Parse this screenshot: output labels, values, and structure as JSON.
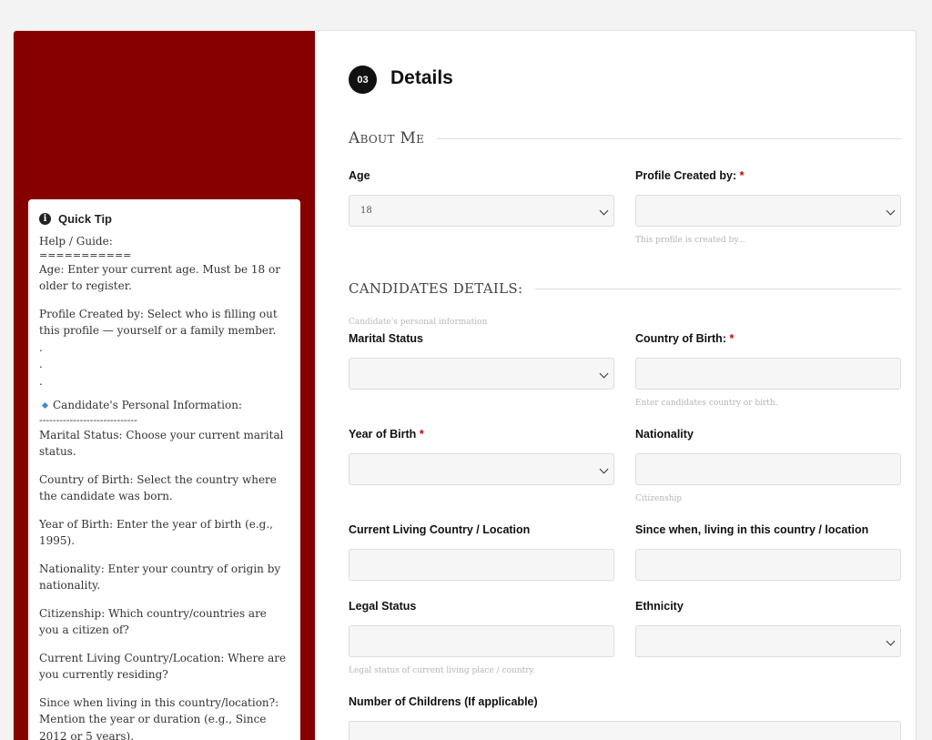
{
  "tip": {
    "title": "Quick Tip",
    "help_heading": "Help / Guide:",
    "help_rule": "===========",
    "age_tip": "Age: Enter your current age. Must be 18 or older to register.",
    "profile_tip": "Profile Created by: Select who is filling out this profile — yourself or a family member.",
    "dot": ".",
    "candidate_heading": "Candidate's Personal Information:",
    "candidate_rule": "-----------------------------",
    "marital_tip": "Marital Status: Choose your current marital status.",
    "country_tip": "Country of Birth: Select the country where the candidate was born.",
    "year_tip": "Year of Birth: Enter the year of birth (e.g., 1995).",
    "nationality_tip": "Nationality: Enter your country of origin by nationality.",
    "citizenship_tip": "Citizenship: Which country/countries are you a citizen of?",
    "living_tip": "Current Living Country/Location: Where are you currently residing?",
    "since_tip": "Since when living in this country/location?: Mention the year or duration (e.g., Since 2012 or 5 years)."
  },
  "step": {
    "number": "03",
    "title": "Details"
  },
  "about": {
    "title": "About Me",
    "age_label": "Age",
    "age_value": "18",
    "profile_label": "Profile Created by:",
    "profile_value": "",
    "profile_hint": "This profile is created by..."
  },
  "candidate": {
    "title": "CANDIDATES DETAILS:",
    "subtitle": "Candidate's personal information",
    "marital_label": "Marital Status",
    "marital_value": "",
    "country_label": "Country of Birth:",
    "country_value": "",
    "country_hint": "Enter candidates country or birth.",
    "year_label": "Year of Birth",
    "year_value": "",
    "nationality_label": "Nationality",
    "nationality_value": "",
    "nationality_hint": "Citizenship",
    "living_label": "Current Living Country / Location",
    "living_value": "",
    "since_label": "Since when, living in this country / location",
    "since_value": "",
    "legal_label": "Legal Status",
    "legal_value": "",
    "legal_hint": "Legal status of current living place / country.",
    "ethnicity_label": "Ethnicity",
    "ethnicity_value": "",
    "children_label": "Number of Childrens (If applicable)",
    "children_value": ""
  },
  "required_marker": "*",
  "colors": {
    "sidebar": "#870000",
    "required": "#cc0000",
    "badge": "#111111"
  }
}
